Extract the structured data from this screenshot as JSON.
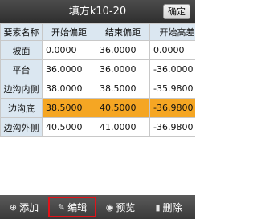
{
  "header": {
    "title": "填方k10-20",
    "confirm_label": "确定"
  },
  "table": {
    "columns": [
      "要素名称",
      "开始偏距",
      "结束偏距",
      "开始高差"
    ],
    "rows": [
      {
        "name": "坡面",
        "start_offset": "0.0000",
        "end_offset": "36.0000",
        "start_height": "0.0000"
      },
      {
        "name": "平台",
        "start_offset": "36.0000",
        "end_offset": "36.0000",
        "start_height": "-36.0000"
      },
      {
        "name": "边沟内侧",
        "start_offset": "38.0000",
        "end_offset": "38.5000",
        "start_height": "-35.9800"
      },
      {
        "name": "边沟底",
        "start_offset": "38.5000",
        "end_offset": "40.5000",
        "start_height": "-36.9800"
      },
      {
        "name": "边沟外侧",
        "start_offset": "40.5000",
        "end_offset": "41.0000",
        "start_height": "-36.9800"
      }
    ],
    "selected_row": "边沟底",
    "selection_color": "#f5a623"
  },
  "toolbar": {
    "add_label": "添加",
    "edit_label": "编辑",
    "preview_label": "预览",
    "delete_label": "删除",
    "add_icon": "plus-circle-icon",
    "edit_icon": "pencil-icon",
    "preview_icon": "eye-icon",
    "delete_icon": "trash-icon",
    "highlight_color": "#e0141a"
  }
}
